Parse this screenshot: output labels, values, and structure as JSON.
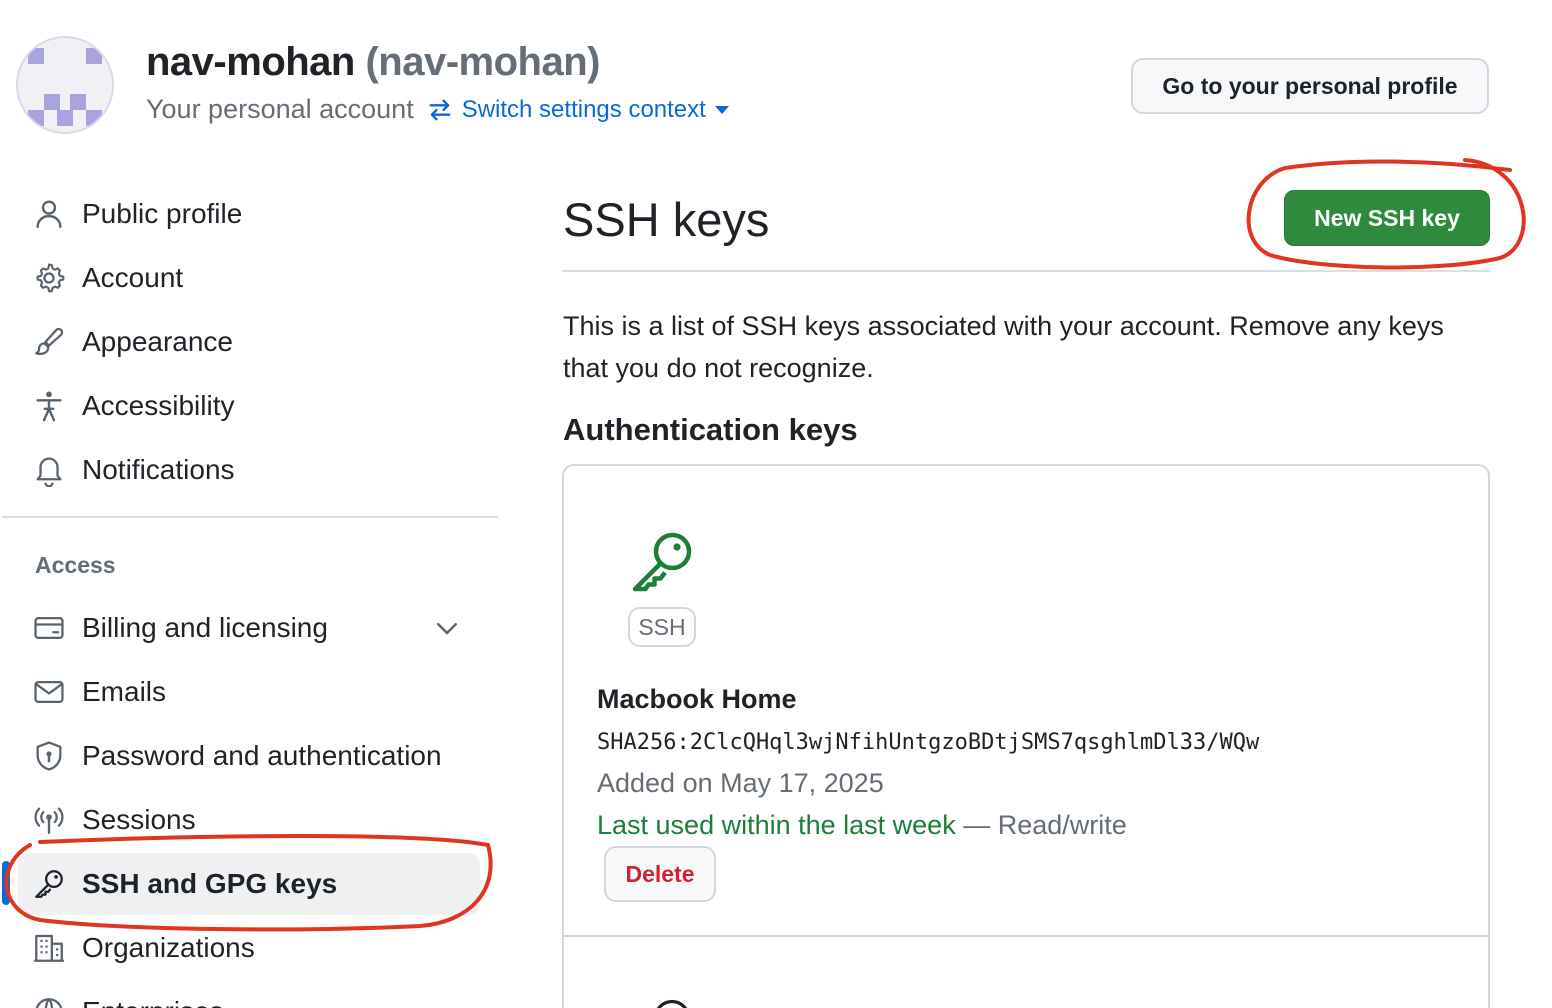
{
  "header": {
    "display_name": "nav-mohan",
    "login": "(nav-mohan)",
    "subtitle": "Your personal account",
    "switch_context_label": "Switch settings context",
    "profile_button_label": "Go to your personal profile"
  },
  "sidebar": {
    "items": [
      {
        "label": "Public profile",
        "icon": "person-icon"
      },
      {
        "label": "Account",
        "icon": "gear-icon"
      },
      {
        "label": "Appearance",
        "icon": "paintbrush-icon"
      },
      {
        "label": "Accessibility",
        "icon": "accessibility-icon"
      },
      {
        "label": "Notifications",
        "icon": "bell-icon"
      }
    ],
    "access_heading": "Access",
    "access_items": [
      {
        "label": "Billing and licensing",
        "icon": "credit-card-icon",
        "expandable": true
      },
      {
        "label": "Emails",
        "icon": "mail-icon"
      },
      {
        "label": "Password and authentication",
        "icon": "shield-lock-icon"
      },
      {
        "label": "Sessions",
        "icon": "broadcast-icon"
      },
      {
        "label": "SSH and GPG keys",
        "icon": "key-icon",
        "active": true
      },
      {
        "label": "Organizations",
        "icon": "organization-icon"
      },
      {
        "label": "Enterprises",
        "icon": "globe-icon"
      }
    ]
  },
  "main": {
    "title": "SSH keys",
    "new_key_button": "New SSH key",
    "intro": "This is a list of SSH keys associated with your account. Remove any keys that you do not recognize.",
    "section_heading": "Authentication keys",
    "keys": [
      {
        "badge": "SSH",
        "title": "Macbook Home",
        "fingerprint": "SHA256:2ClcQHql3wjNfihUntgzoBDtjSMS7qsghlmDl33/WQw",
        "added": "Added on May 17, 2025",
        "last_used": "Last used within the last week",
        "access": " — Read/write",
        "delete_label": "Delete"
      }
    ]
  },
  "colors": {
    "link": "#0969da",
    "primary_button": "#2f8a3e",
    "danger": "#cf222e",
    "success": "#1a7f37",
    "annotation": "#e0351f"
  }
}
